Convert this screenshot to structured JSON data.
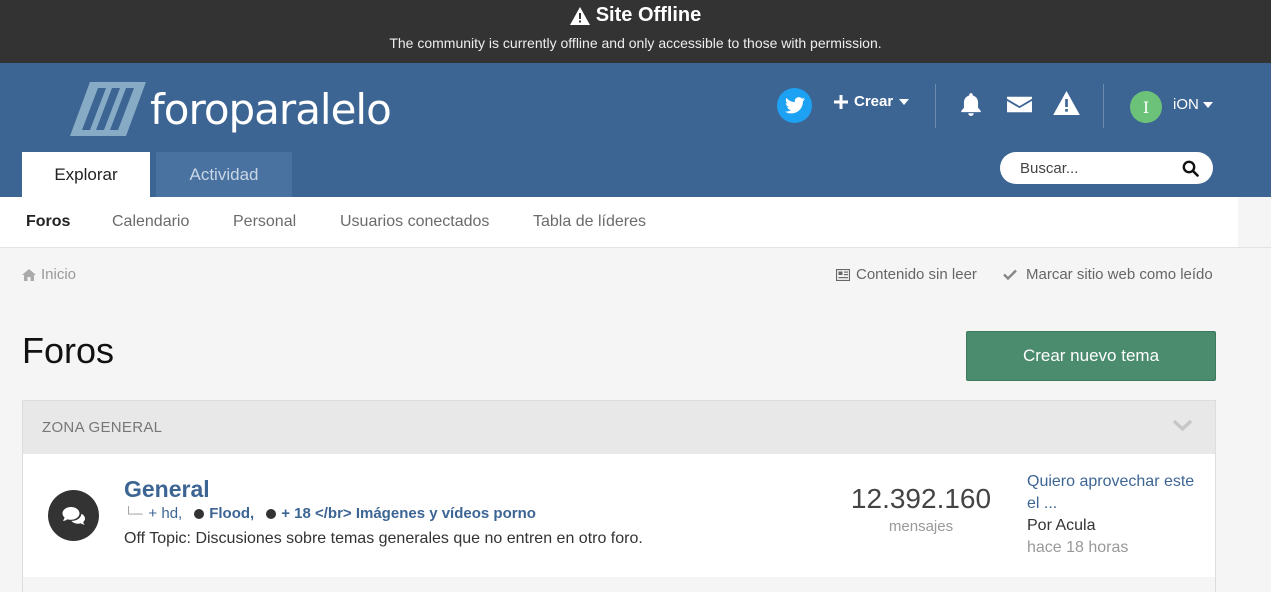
{
  "offline_banner": {
    "title": "Site Offline",
    "message": "The community is currently offline and only accessible to those with permission."
  },
  "header": {
    "logo_text": "foroparalelo",
    "create_label": "Crear",
    "user_initial": "I",
    "username": "iON",
    "tabs": [
      {
        "label": "Explorar"
      },
      {
        "label": "Actividad"
      }
    ],
    "search_placeholder": "Buscar..."
  },
  "subnav": {
    "items": [
      {
        "label": "Foros"
      },
      {
        "label": "Calendario"
      },
      {
        "label": "Personal"
      },
      {
        "label": "Usuarios conectados"
      },
      {
        "label": "Tabla de líderes"
      }
    ]
  },
  "breadcrumb": {
    "home": "Inicio",
    "unread": "Contenido sin leer",
    "mark_read": "Marcar sitio web como leído"
  },
  "page": {
    "title": "Foros",
    "new_topic": "Crear nuevo tema"
  },
  "section": {
    "title": "ZONA GENERAL",
    "forum": {
      "title": "General",
      "subforums": [
        "+ hd,",
        "Flood,",
        "+ 18 </br> Imágenes y vídeos porno"
      ],
      "description": "Off Topic: Discusiones sobre temas generales que no entren en otro foro.",
      "posts_count": "12.392.160",
      "posts_label": "mensajes",
      "last_post_title": "Quiero aprovechar este el ...",
      "last_post_by": "Por Acula",
      "last_post_time": "hace 18 horas"
    }
  },
  "colors": {
    "header_bg": "#3d6594",
    "banner_bg": "#333333",
    "button_green": "#4b8c6f",
    "twitter": "#1da1f2",
    "avatar": "#6dc27a"
  }
}
